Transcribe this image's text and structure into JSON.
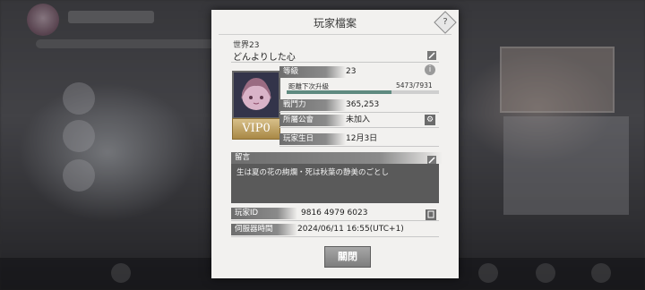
{
  "dialog": {
    "title": "玩家檔案",
    "help_icon": "help-diamond-icon",
    "server": "世界23",
    "player_name": "どんよりした心",
    "vip": "VIP0",
    "level": {
      "label": "等級",
      "value": "23"
    },
    "exp": {
      "label": "距離下次升級",
      "value": "5473/7931",
      "current": 5473,
      "max": 7931
    },
    "power": {
      "label": "戰鬥力",
      "value": "365,253"
    },
    "guild": {
      "label": "所屬公會",
      "value": "未加入"
    },
    "birthday": {
      "label": "玩家生日",
      "value": "12月3日"
    },
    "message": {
      "label": "留言",
      "text": "生は夏の花の絢爛・死は秋葉の静美のごとし"
    },
    "player_id": {
      "label": "玩家ID",
      "value": "9816 4979 6023"
    },
    "server_time": {
      "label": "伺服器時間",
      "value": "2024/06/11 16:55(UTC+1)"
    },
    "close_label": "關閉",
    "accent_color": "#5f8a80"
  }
}
